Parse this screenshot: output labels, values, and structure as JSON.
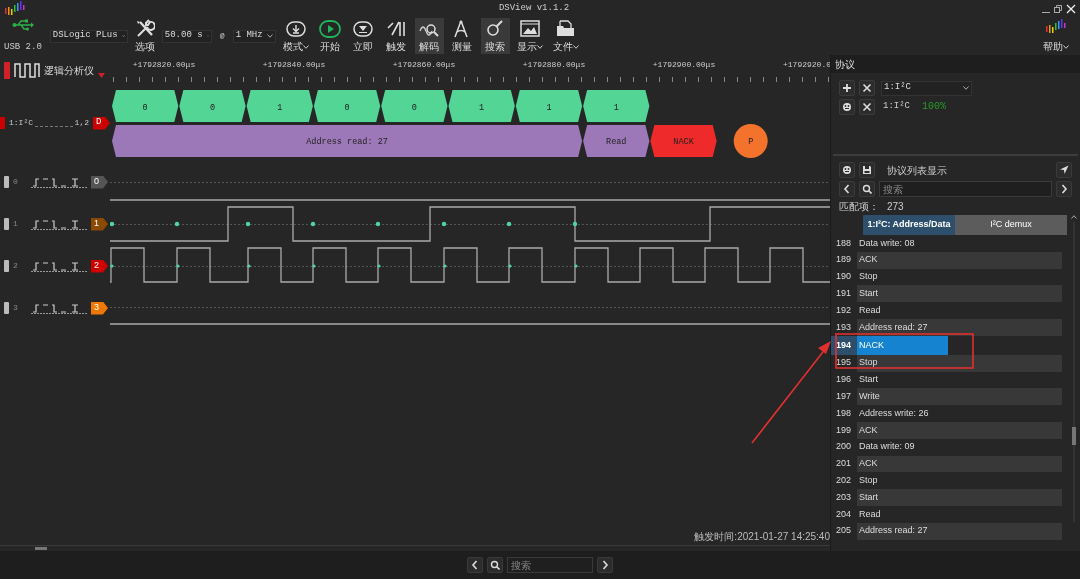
{
  "window": {
    "title": "DSView v1.1.2"
  },
  "toolbar": {
    "usb_label": "USB 2.0",
    "device": "DSLogic PLus",
    "options_label": "选项",
    "duration": "50.00 s",
    "at": "@",
    "rate": "1 MHz",
    "buttons": [
      {
        "label": "模式",
        "kind": "download",
        "dropdown": true,
        "selected": false
      },
      {
        "label": "开始",
        "kind": "play",
        "dropdown": false,
        "selected": false
      },
      {
        "label": "立即",
        "kind": "instant",
        "dropdown": false,
        "selected": false
      },
      {
        "label": "触发",
        "kind": "trigger",
        "dropdown": false,
        "selected": false
      },
      {
        "label": "解码",
        "kind": "decode",
        "dropdown": false,
        "selected": true
      },
      {
        "label": "测量",
        "kind": "measure",
        "dropdown": false,
        "selected": false
      },
      {
        "label": "搜索",
        "kind": "search",
        "dropdown": false,
        "selected": true
      },
      {
        "label": "显示",
        "kind": "display",
        "dropdown": true,
        "selected": false
      },
      {
        "label": "文件",
        "kind": "file",
        "dropdown": true,
        "selected": false
      }
    ],
    "help": {
      "label": "帮助",
      "dropdown": true
    }
  },
  "mode_label": "逻辑分析仪",
  "ruler_labels": [
    "+1792820.00μs",
    "+1792840.00μs",
    "+1792860.00μs",
    "+1792880.00μs",
    "+1792900.00μs",
    "+1792920.0"
  ],
  "decoder": {
    "name": "1:I²C",
    "channels": "1,2",
    "tag": "D",
    "color": "#cc0000",
    "bits": [
      "0",
      "0",
      "1",
      "0",
      "0",
      "1",
      "1",
      "1"
    ],
    "fields": [
      {
        "kind": "address",
        "text": "Address read: 27"
      },
      {
        "kind": "rw",
        "text": "Read"
      },
      {
        "kind": "ack",
        "text": "NACK"
      },
      {
        "kind": "stop",
        "text": "P"
      }
    ]
  },
  "channels": [
    {
      "index": "0",
      "tag": "0",
      "color": "#555555"
    },
    {
      "index": "1",
      "tag": "1",
      "color": "#8a4b00"
    },
    {
      "index": "2",
      "tag": "2",
      "color": "#d00000"
    },
    {
      "index": "3",
      "tag": "3",
      "color": "#f07800"
    }
  ],
  "status": {
    "trigger_time": "触发时间:2021-01-27 14:25:40"
  },
  "protocol_panel": {
    "title": "协议",
    "add_select": "1:I²C",
    "decoders": [
      {
        "name": "1:I²C",
        "percent": "100%"
      }
    ],
    "list_title": "协议列表显示",
    "search": {
      "placeholder": "搜索"
    },
    "match_label": "匹配项：",
    "match_count": "273",
    "columns": [
      {
        "label": "1:I²C: Address/Data",
        "selected": true
      },
      {
        "label": "I²C demux",
        "selected": false
      }
    ],
    "rows": [
      {
        "number": "188",
        "text": "Data write: 08",
        "selected": false
      },
      {
        "number": "189",
        "text": "ACK",
        "selected": false
      },
      {
        "number": "190",
        "text": "Stop",
        "selected": false
      },
      {
        "number": "191",
        "text": "Start",
        "selected": false
      },
      {
        "number": "192",
        "text": "Read",
        "selected": false
      },
      {
        "number": "193",
        "text": "Address read: 27",
        "selected": false
      },
      {
        "number": "194",
        "text": "NACK",
        "selected": true
      },
      {
        "number": "195",
        "text": "Stop",
        "selected": false
      },
      {
        "number": "196",
        "text": "Start",
        "selected": false
      },
      {
        "number": "197",
        "text": "Write",
        "selected": false
      },
      {
        "number": "198",
        "text": "Address write: 26",
        "selected": false
      },
      {
        "number": "199",
        "text": "ACK",
        "selected": false
      },
      {
        "number": "200",
        "text": "Data write: 09",
        "selected": false
      },
      {
        "number": "201",
        "text": "ACK",
        "selected": false
      },
      {
        "number": "202",
        "text": "Stop",
        "selected": false
      },
      {
        "number": "203",
        "text": "Start",
        "selected": false
      },
      {
        "number": "204",
        "text": "Read",
        "selected": false
      },
      {
        "number": "205",
        "text": "Address read: 27",
        "selected": false
      }
    ]
  },
  "bottom_search": {
    "placeholder": "搜索"
  }
}
